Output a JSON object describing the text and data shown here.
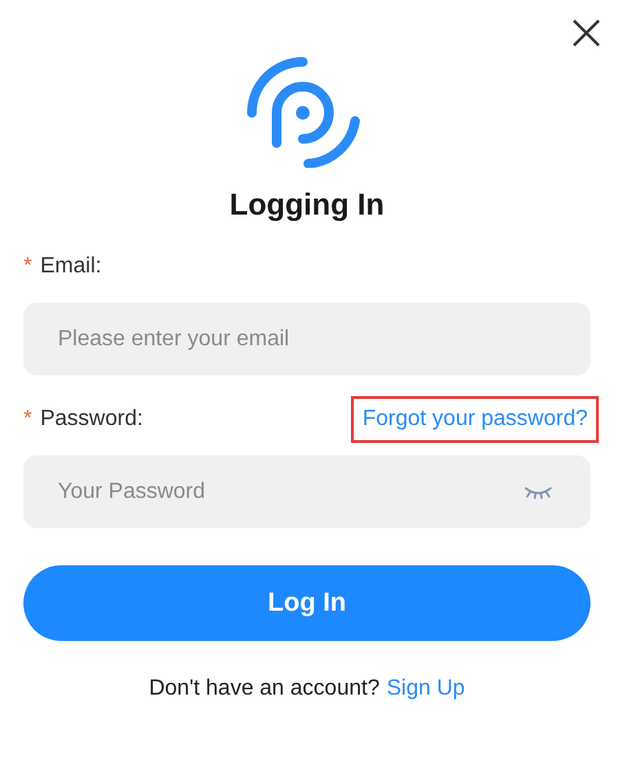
{
  "title": "Logging In",
  "fields": [
    {
      "label": "Email:",
      "required": true,
      "placeholder": "Please enter your email",
      "kind": "text"
    },
    {
      "label": "Password:",
      "required": true,
      "placeholder": "Your Password",
      "kind": "password",
      "link": {
        "text": "Forgot your password?",
        "highlighted": true
      }
    }
  ],
  "required_mark": "*",
  "submit": "Log In",
  "footer": {
    "text": "Don't have an account?",
    "link": "Sign Up"
  }
}
